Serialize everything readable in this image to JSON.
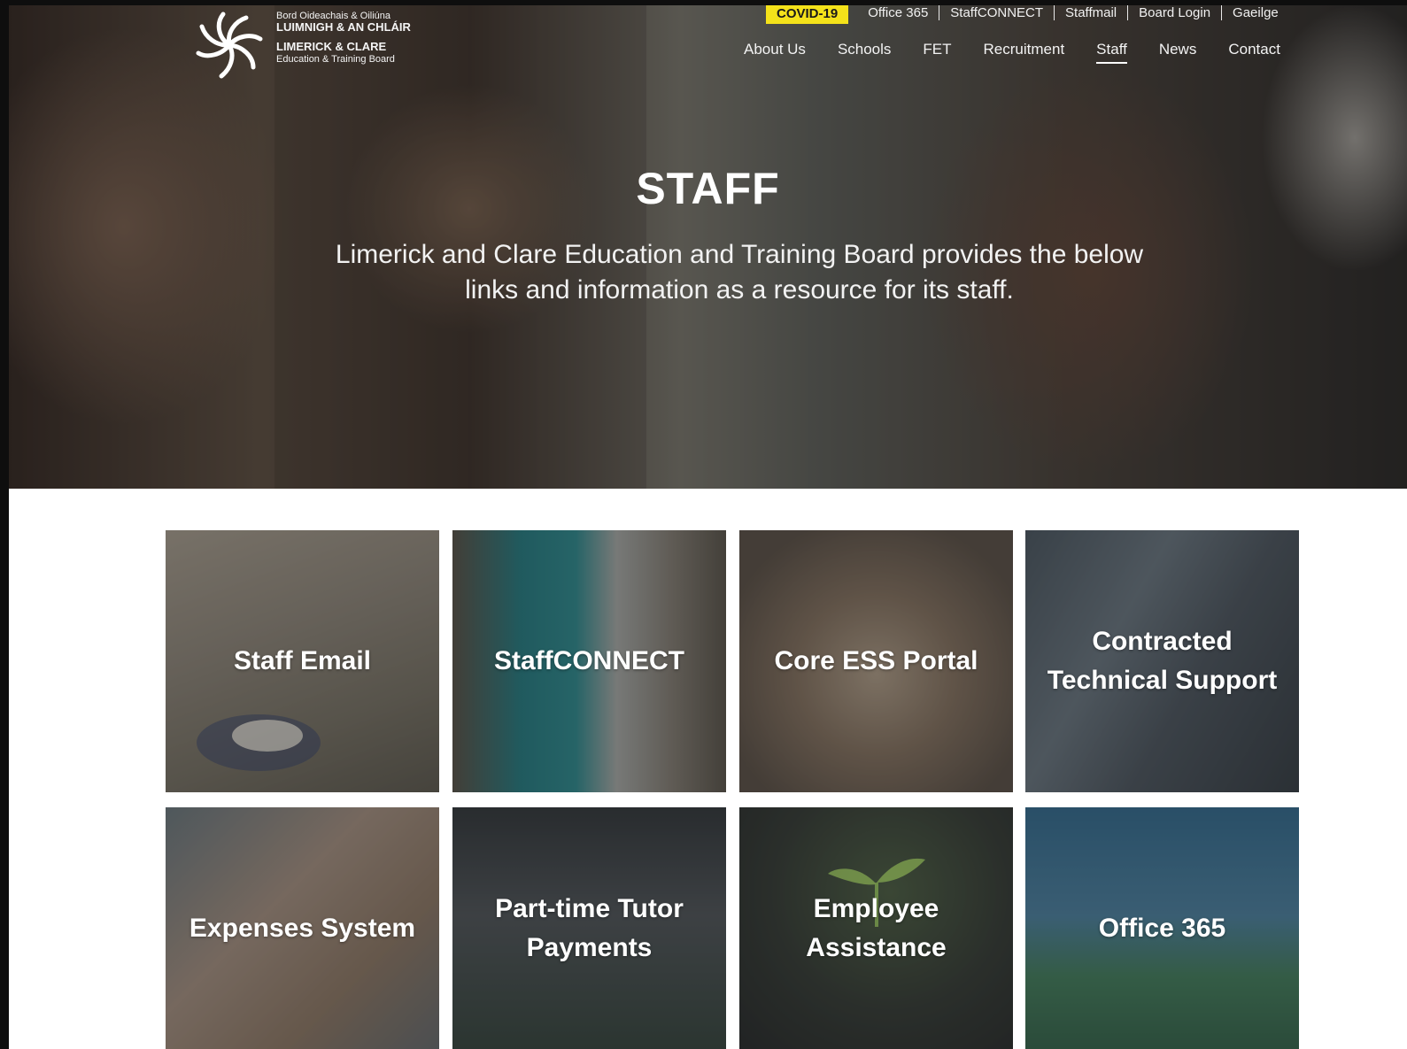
{
  "topbar": {
    "covid_label": "COVID-19",
    "links": [
      "Office 365",
      "StaffCONNECT",
      "Staffmail",
      "Board Login",
      "Gaeilge"
    ]
  },
  "logo": {
    "line1": "Bord Oideachais & Oiliúna",
    "line2": "LUIMNIGH & AN CHLÁIR",
    "line3": "LIMERICK & CLARE",
    "line4": "Education & Training Board"
  },
  "nav": {
    "items": [
      "About Us",
      "Schools",
      "FET",
      "Recruitment",
      "Staff",
      "News",
      "Contact"
    ],
    "active": "Staff"
  },
  "hero": {
    "title": "STAFF",
    "subtitle": "Limerick and Clare Education and Training Board provides the below links and information as a resource for its staff."
  },
  "tiles": [
    {
      "label": "Staff Email"
    },
    {
      "label": "StaffCONNECT"
    },
    {
      "label": "Core ESS Portal"
    },
    {
      "label": "Contracted Technical Support"
    },
    {
      "label": "Expenses System"
    },
    {
      "label": "Part-time Tutor Payments"
    },
    {
      "label": "Employee Assistance"
    },
    {
      "label": "Office 365"
    }
  ],
  "colors": {
    "covid_badge": "#f4e21a",
    "frame": "#0e0e0e",
    "text_light": "#ffffff"
  }
}
